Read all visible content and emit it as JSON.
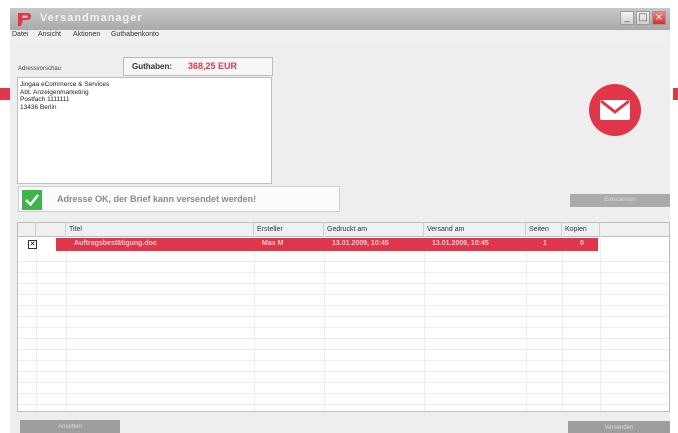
{
  "window": {
    "title": "Versandmanager"
  },
  "menu": [
    "Datei",
    "Ansicht",
    "Aktionen",
    "Guthabenkonto"
  ],
  "balance": {
    "label": "Guthaben:",
    "value": "368,25 EUR"
  },
  "address": {
    "label": "Adressvorschau",
    "lines": [
      "Jingaa eCommerce & Services",
      "Abt. Anzeigenmarketing",
      "Postfach 1111111",
      "13436 Berlin"
    ]
  },
  "status": {
    "message": "Adresse OK, der Brief kann versendet werden!"
  },
  "buttons": {
    "right_top": "Einscannen",
    "bottom_left": "Ansehen",
    "bottom_right": "Versenden"
  },
  "table": {
    "columns": [
      "Titel",
      "Ersteller",
      "Gedruckt am",
      "Versand am",
      "Seiten",
      "Kopien"
    ],
    "rows": [
      {
        "titel": "Auftragsbestätigung.doc",
        "ersteller": "Max M",
        "gedruckt": "13.01.2009, 10:45",
        "versand": "13.01.2009, 10:45",
        "seiten": "1",
        "kopien": "0"
      }
    ]
  },
  "colors": {
    "accent": "#e0364a",
    "ok": "#3db54a"
  }
}
